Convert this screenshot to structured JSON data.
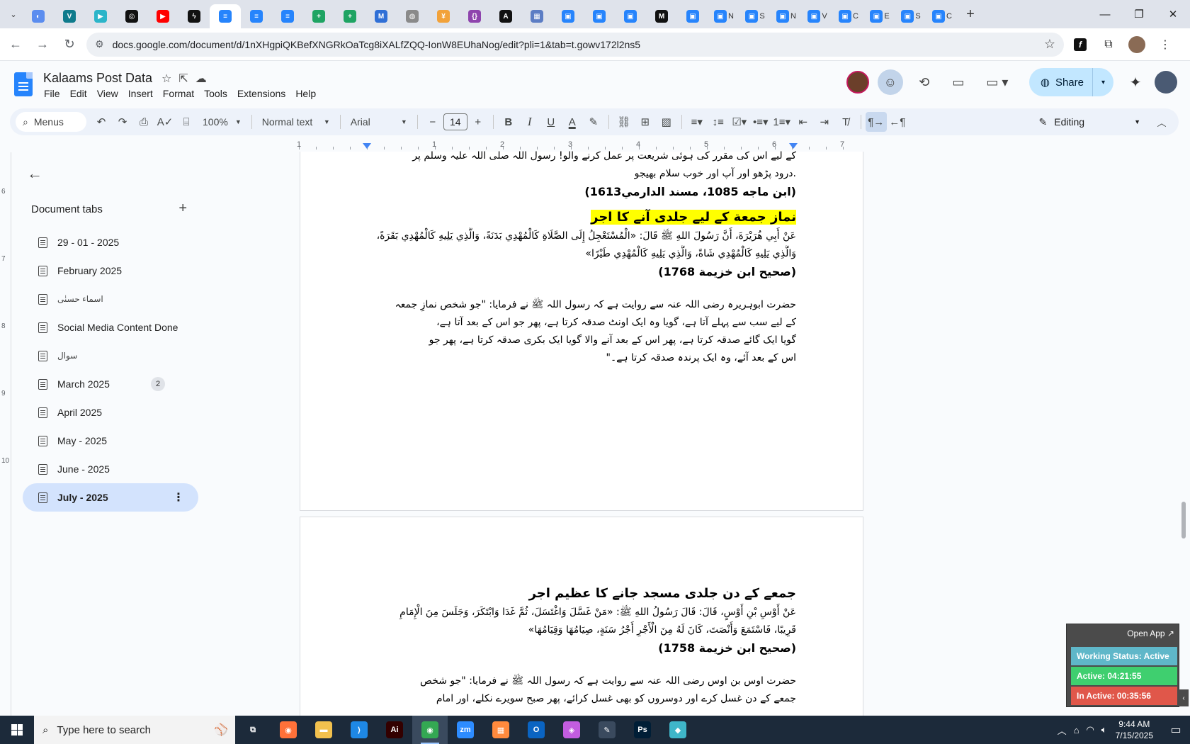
{
  "browser": {
    "tabs": [
      {
        "icon": "circle-blue-icon",
        "color": "#5b8def",
        "glyph": "◐",
        "active": false
      },
      {
        "icon": "vpn-icon",
        "color": "#0f7b8c",
        "glyph": "V",
        "active": false
      },
      {
        "icon": "hex-icon",
        "color": "#2bb5c9",
        "glyph": "▶",
        "active": false
      },
      {
        "icon": "chatgpt-icon",
        "color": "#111111",
        "glyph": "◎",
        "active": false
      },
      {
        "icon": "youtube-icon",
        "color": "#ff0000",
        "glyph": "▶",
        "active": false
      },
      {
        "icon": "bolt-icon",
        "color": "#111111",
        "glyph": "ϟ",
        "active": false
      },
      {
        "icon": "docs-icon",
        "color": "#2684fc",
        "glyph": "≡",
        "active": true
      },
      {
        "icon": "docs-icon",
        "color": "#2684fc",
        "glyph": "≡",
        "active": false
      },
      {
        "icon": "docs-icon",
        "color": "#2684fc",
        "glyph": "≡",
        "active": false
      },
      {
        "icon": "sheets-icon",
        "color": "#1fa463",
        "glyph": "+",
        "active": false
      },
      {
        "icon": "sheets-icon",
        "color": "#1fa463",
        "glyph": "+",
        "active": false
      },
      {
        "icon": "office-icon",
        "color": "#2f6fd6",
        "glyph": "M",
        "active": false
      },
      {
        "icon": "globe-icon",
        "color": "#8a8a8a",
        "glyph": "◍",
        "active": false
      },
      {
        "icon": "fox-icon",
        "color": "#f2a23a",
        "glyph": "¥",
        "active": false
      },
      {
        "icon": "code-icon",
        "color": "#8e44ad",
        "glyph": "{}",
        "active": false
      },
      {
        "icon": "ai-icon",
        "color": "#111111",
        "glyph": "A",
        "active": false
      },
      {
        "icon": "grid-icon",
        "color": "#5c7dc4",
        "glyph": "▦",
        "active": false
      },
      {
        "icon": "forms-icon",
        "color": "#2684fc",
        "glyph": "▣",
        "active": false
      },
      {
        "icon": "forms-icon",
        "color": "#2684fc",
        "glyph": "▣",
        "active": false
      },
      {
        "icon": "forms-icon",
        "color": "#2684fc",
        "glyph": "▣",
        "active": false
      },
      {
        "icon": "medium-icon",
        "color": "#111111",
        "glyph": "M",
        "active": false
      },
      {
        "icon": "forms-icon",
        "color": "#2684fc",
        "glyph": "▣",
        "active": false
      },
      {
        "icon": "forms-icon",
        "color": "#2684fc",
        "glyph": "▣",
        "label": "N",
        "active": false
      },
      {
        "icon": "forms-icon",
        "color": "#2684fc",
        "glyph": "▣",
        "label": "S",
        "active": false
      },
      {
        "icon": "forms-icon",
        "color": "#2684fc",
        "glyph": "▣",
        "label": "N",
        "active": false
      },
      {
        "icon": "forms-icon",
        "color": "#2684fc",
        "glyph": "▣",
        "label": "V",
        "active": false
      },
      {
        "icon": "forms-icon",
        "color": "#2684fc",
        "glyph": "▣",
        "label": "C",
        "active": false
      },
      {
        "icon": "forms-icon",
        "color": "#2684fc",
        "glyph": "▣",
        "label": "E",
        "active": false
      },
      {
        "icon": "forms-icon",
        "color": "#2684fc",
        "glyph": "▣",
        "label": "S",
        "active": false
      },
      {
        "icon": "forms-icon",
        "color": "#2684fc",
        "glyph": "▣",
        "label": "C",
        "active": false
      }
    ],
    "url": "docs.google.com/document/d/1nXHgpiQKBefXNGRkOaTcg8iXALfZQQ-IonW8EUhaNog/edit?pli=1&tab=t.gowv172l2ns5"
  },
  "docs": {
    "title": "Kalaams Post Data",
    "menu": [
      "File",
      "Edit",
      "View",
      "Insert",
      "Format",
      "Tools",
      "Extensions",
      "Help"
    ],
    "share_label": "Share",
    "toolbar": {
      "menus_label": "Menus",
      "zoom": "100%",
      "style": "Normal text",
      "font": "Arial",
      "font_size": "14",
      "mode": "Editing"
    },
    "ruler_numbers": [
      "1",
      "1",
      "2",
      "3",
      "4",
      "5",
      "6",
      "7"
    ]
  },
  "sidebar": {
    "header": "Document tabs",
    "tabs": [
      {
        "label": "29 - 01 - 2025",
        "badge": "",
        "active": false,
        "small": false
      },
      {
        "label": "February 2025",
        "badge": "",
        "active": false,
        "small": false
      },
      {
        "label": "اسماء حسنٰی",
        "badge": "",
        "active": false,
        "small": true
      },
      {
        "label": "Social Media Content Done",
        "badge": "",
        "active": false,
        "small": false
      },
      {
        "label": "سوال",
        "badge": "",
        "active": false,
        "small": true
      },
      {
        "label": "March 2025",
        "badge": "2",
        "active": false,
        "small": false
      },
      {
        "label": "April 2025",
        "badge": "",
        "active": false,
        "small": false
      },
      {
        "label": "May - 2025",
        "badge": "",
        "active": false,
        "small": false
      },
      {
        "label": "June - 2025",
        "badge": "",
        "active": false,
        "small": false
      },
      {
        "label": "July - 2025",
        "badge": "",
        "active": true,
        "small": false
      }
    ]
  },
  "page1": {
    "lines_top": [
      "کے لیے اس کی مقرر کی ہوئی شریعت پر عمل کرنے والو! رسول اللہ صلی اللہ علیہ وسلم پر",
      ".درود پڑھو اور آپ اور خوب سلام بھیجو"
    ],
    "ref1": "(ابن ماجه 1085، مسند الدارمي1613)",
    "heading": "نماز جمعة کے لیے جلدی آنے کا اجر",
    "arabic": [
      "عَنْ أَبِي هُرَيْرَةَ، أَنَّ رَسُولَ اللهِ ﷺ قَالَ: «الْمُسْتَعْجِلُ إِلَى الصَّلَاةِ كَالْمُهْدِي بَدَنَةً، وَالَّذِي يَلِيهِ كَالْمُهْدِي بَقَرَةً،",
      "وَالَّذِي يَلِيهِ كَالْمُهْدِي شَاةً، وَالَّذِي يَلِيهِ كَالْمُهْدِي طَيْرًا»"
    ],
    "ref2": "(صحيح ابن خزيمة 1768)",
    "urdu": [
      "حضرت ابوہریرہ رضی اللہ عنہ سے روایت ہے کہ رسول اللہ ﷺ نے فرمایا: \"جو شخص نمازِ جمعہ",
      "کے لیے سب سے پہلے آتا ہے، گویا وہ ایک اونٹ صدقہ کرتا ہے، پھر جو اس کے بعد آتا ہے،",
      "گویا ایک گائے صدقہ کرتا ہے، پھر اس کے بعد آنے والا گویا ایک بکری صدقہ کرتا ہے، پھر جو",
      "اس کے بعد آئے، وہ ایک پرندہ صدقہ کرتا ہے۔\""
    ]
  },
  "page2": {
    "heading": "جمعے کے دن جلدی مسجد جانے کا عظیم اجر",
    "arabic": [
      "عَنْ أَوْسِ بْنِ أَوْسٍ، قَالَ: قَالَ رَسُولُ اللهِ ﷺ: «مَنْ غَسَّلَ وَاغْتَسَلَ، ثُمَّ غَدَا وَابْتَكَرَ، وَجَلَسَ مِنَ الْإِمَامِ",
      "قَرِيبًا، فَاسْتَمَعَ وَأَنْصَتَ، كَانَ لَهُ مِنَ الْأَجْرِ أَجْرُ سَنَةٍ، صِيَامُهَا وَقِيَامُهَا»"
    ],
    "ref": "(صحيح ابن خزيمة 1758)",
    "urdu": [
      "حضرت اوس بن اوس رضی اللہ عنہ سے روایت ہے کہ رسول اللہ ﷺ نے فرمایا: \"جو شخص",
      "جمعے کے دن غسل کرے اور دوسروں کو بھی غسل کرائے، پھر صبح سویرے نکلے، اور امام"
    ]
  },
  "status_widget": {
    "open_app": "Open App ↗",
    "working": "Working Status: Active",
    "active": "Active: 04:21:55",
    "inactive": "In Active: 00:35:56"
  },
  "taskbar": {
    "search_placeholder": "Type here to search",
    "apps": [
      {
        "icon": "task-view-icon",
        "color": "#1c2a3a",
        "glyph": "⧉",
        "active": false
      },
      {
        "icon": "firefox-icon",
        "color": "#ff7139",
        "glyph": "◉",
        "active": false
      },
      {
        "icon": "file-explorer-icon",
        "color": "#f2c14e",
        "glyph": "▬",
        "active": false
      },
      {
        "icon": "vscode-icon",
        "color": "#1e88e5",
        "glyph": "⟩",
        "active": false
      },
      {
        "icon": "illustrator-icon",
        "color": "#330000",
        "glyph": "Ai",
        "active": false
      },
      {
        "icon": "chrome-icon",
        "color": "#34a853",
        "glyph": "◉",
        "active": true
      },
      {
        "icon": "zoom-icon",
        "color": "#2d8cff",
        "glyph": "zm",
        "active": false
      },
      {
        "icon": "app-grid-icon",
        "color": "#ff8a3d",
        "glyph": "▦",
        "active": false
      },
      {
        "icon": "outlook-icon",
        "color": "#0a64c2",
        "glyph": "O",
        "active": false
      },
      {
        "icon": "photos-icon",
        "color": "#c25de0",
        "glyph": "◈",
        "active": false
      },
      {
        "icon": "pen-icon",
        "color": "#3a4a5e",
        "glyph": "✎",
        "active": false
      },
      {
        "icon": "photoshop-icon",
        "color": "#001e36",
        "glyph": "Ps",
        "active": false
      },
      {
        "icon": "gem-app-icon",
        "color": "#3fb6c9",
        "glyph": "◆",
        "active": false
      }
    ],
    "time": "9:44 AM",
    "date": "7/15/2025"
  }
}
